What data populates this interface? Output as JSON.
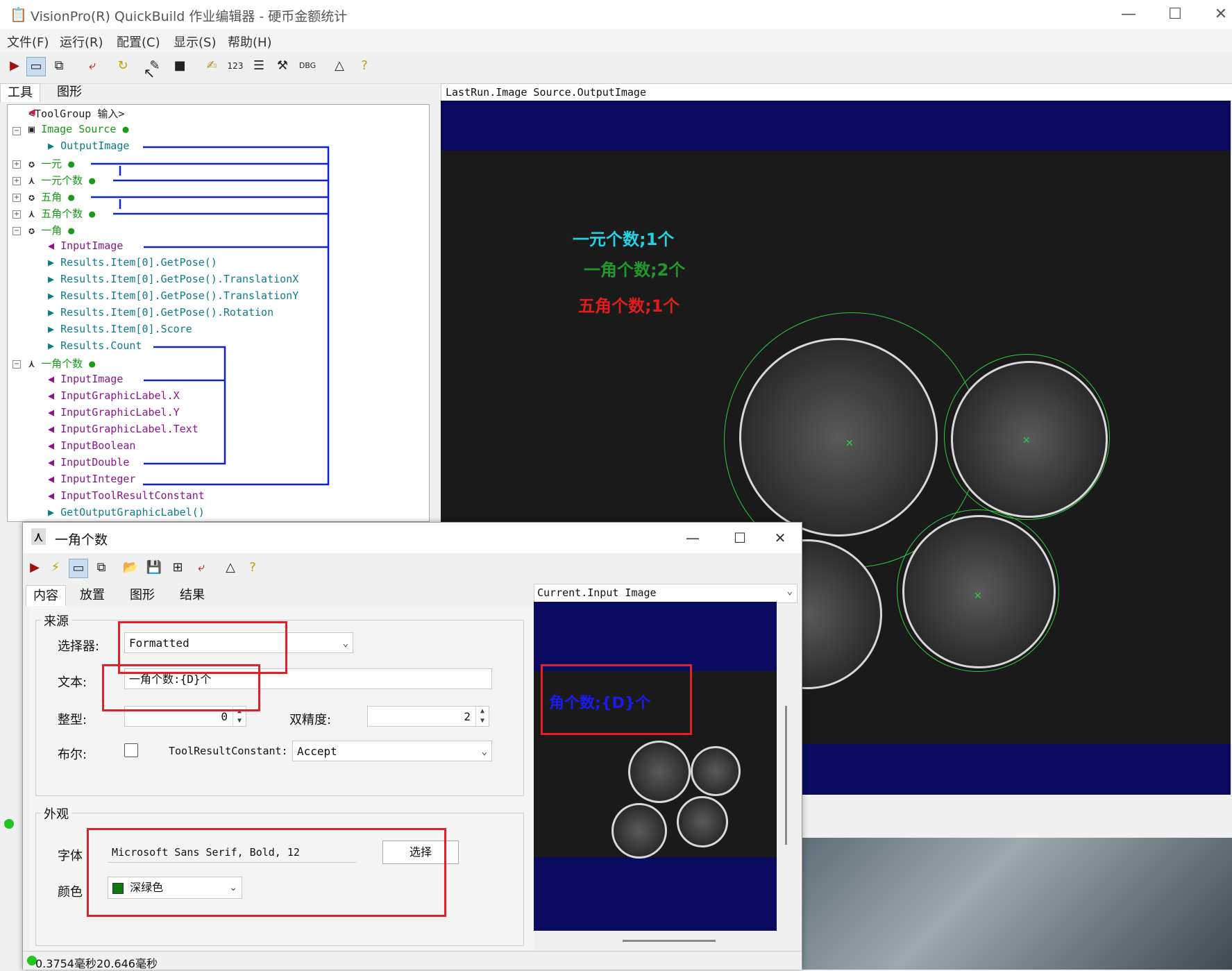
{
  "window": {
    "title": "VisionPro(R) QuickBuild 作业编辑器 - 硬币金额统计",
    "minimize": "—",
    "maximize": "☐",
    "close": "✕"
  },
  "menu": [
    "文件(F)",
    "运行(R)",
    "配置(C)",
    "显示(S)",
    "帮助(H)"
  ],
  "left_tabs": [
    "工具",
    "图形"
  ],
  "tree": [
    {
      "text": "<ToolGroup 输入>",
      "color": "dark"
    },
    {
      "text": "Image Source",
      "color": "green"
    },
    {
      "text": "OutputImage",
      "color": "teal"
    },
    {
      "text": "一元",
      "color": "green"
    },
    {
      "text": "一元个数",
      "color": "green"
    },
    {
      "text": "五角",
      "color": "green"
    },
    {
      "text": "五角个数",
      "color": "green"
    },
    {
      "text": "一角",
      "color": "green"
    },
    {
      "text": "InputImage",
      "color": "purple"
    },
    {
      "text": "Results.Item[0].GetPose()",
      "color": "teal"
    },
    {
      "text": "Results.Item[0].GetPose().TranslationX",
      "color": "teal"
    },
    {
      "text": "Results.Item[0].GetPose().TranslationY",
      "color": "teal"
    },
    {
      "text": "Results.Item[0].GetPose().Rotation",
      "color": "teal"
    },
    {
      "text": "Results.Item[0].Score",
      "color": "teal"
    },
    {
      "text": "Results.Count",
      "color": "teal"
    },
    {
      "text": "一角个数",
      "color": "green"
    },
    {
      "text": "InputImage",
      "color": "purple"
    },
    {
      "text": "InputGraphicLabel.X",
      "color": "purple"
    },
    {
      "text": "InputGraphicLabel.Y",
      "color": "purple"
    },
    {
      "text": "InputGraphicLabel.Text",
      "color": "purple"
    },
    {
      "text": "InputBoolean",
      "color": "purple"
    },
    {
      "text": "InputDouble",
      "color": "purple"
    },
    {
      "text": "InputInteger",
      "color": "purple"
    },
    {
      "text": "InputToolResultConstant",
      "color": "purple"
    },
    {
      "text": "GetOutputGraphicLabel()",
      "color": "teal"
    }
  ],
  "display": {
    "label": "LastRun.Image Source.OutputImage",
    "overlay": [
      {
        "text": "一元个数;1个",
        "color": "#22d3e6"
      },
      {
        "text": "一角个数;2个",
        "color": "#1f9a2a"
      },
      {
        "text": "五角个数;1个",
        "color": "#e01c1c"
      }
    ]
  },
  "dialog": {
    "title": "一角个数",
    "tabs": [
      "内容",
      "放置",
      "图形",
      "结果"
    ],
    "source_group": "来源",
    "selector_label": "选择器:",
    "selector_value": "Formatted",
    "text_label": "文本:",
    "text_value": "一角个数:{D}个",
    "int_label": "整型:",
    "int_value": "0",
    "double_label": "双精度:",
    "double_value": "2",
    "bool_label": "布尔:",
    "trc_label": "ToolResultConstant:",
    "trc_value": "Accept",
    "appearance_group": "外观",
    "font_label": "字体",
    "font_value": "Microsoft Sans Serif, Bold, 12",
    "font_button": "选择",
    "color_label": "颜色",
    "color_value": "深绿色",
    "color_swatch": "#0c7a0c",
    "preview_label": "Current.Input Image",
    "preview_overlay": "角个数;{D}个",
    "status": "0.3754毫秒20.646毫秒"
  }
}
